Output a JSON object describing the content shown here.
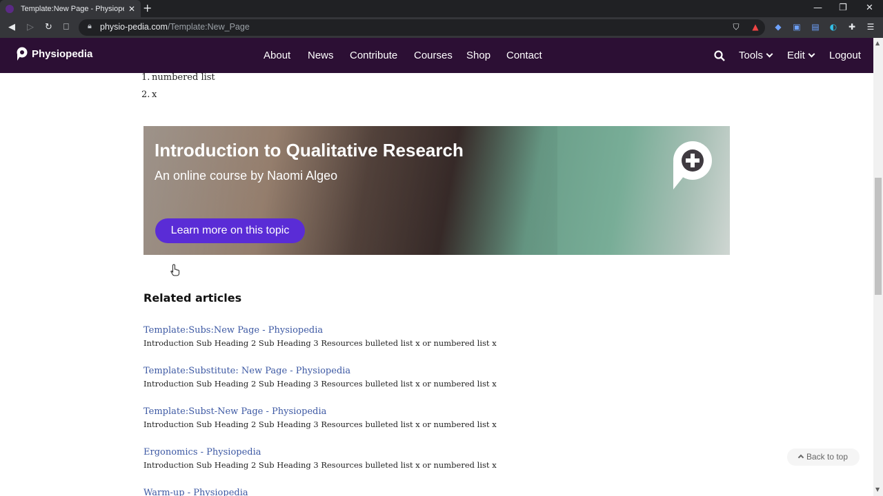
{
  "browser": {
    "tab_title": "Template:New Page - Physiopedia",
    "tab_close": "✕",
    "new_tab": "+",
    "url_domain": "physio-pedia.com",
    "url_path": "/Template:New_Page",
    "window_controls": [
      "—",
      "❐",
      "✕"
    ]
  },
  "site": {
    "logo_text": "Physiopedia",
    "menu": {
      "about": "About",
      "news": "News",
      "contribute": "Contribute",
      "courses": "Courses",
      "shop": "Shop",
      "contact": "Contact",
      "tools": "Tools",
      "edit": "Edit",
      "logout": "Logout"
    }
  },
  "content": {
    "list": [
      {
        "num": "1.",
        "text": "numbered list"
      },
      {
        "num": "2.",
        "text": "x"
      }
    ],
    "banner": {
      "title": "Introduction to Qualitative Research",
      "subtitle": "An online course by Naomi Algeo",
      "button": "Learn more on this topic"
    },
    "related_heading": "Related articles",
    "articles": [
      {
        "title": "Template:Subs:New Page - Physiopedia",
        "desc": "Introduction Sub Heading 2 Sub Heading 3 Resources bulleted list x or numbered list x"
      },
      {
        "title": "Template:Substitute: New Page - Physiopedia",
        "desc": "Introduction Sub Heading 2 Sub Heading 3 Resources bulleted list x or numbered list x"
      },
      {
        "title": "Template:Subst-New Page - Physiopedia",
        "desc": "Introduction Sub Heading 2 Sub Heading 3 Resources bulleted list x or numbered list x"
      },
      {
        "title": "Ergonomics - Physiopedia",
        "desc": "Introduction Sub Heading 2 Sub Heading 3 Resources bulleted list x or numbered list x"
      },
      {
        "title": "Warm-up - Physiopedia",
        "desc": ""
      }
    ],
    "back_to_top": "Back to top"
  },
  "colors": {
    "nav_bg": "#2c0f34",
    "button_purple": "#5a2cd6",
    "link_blue": "#3c58a3"
  }
}
